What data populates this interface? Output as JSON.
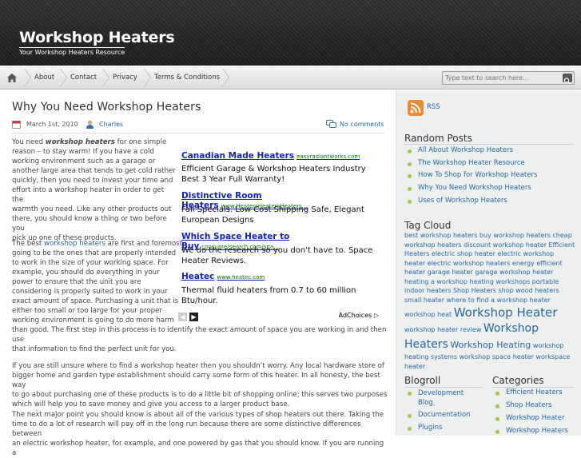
{
  "site": {
    "title": "Workshop Heaters",
    "description": "Your Workshop Heaters Resource"
  },
  "nav": {
    "items": [
      "About",
      "Contact",
      "Privacy",
      "Terms & Conditions"
    ]
  },
  "search": {
    "placeholder": "Type text to search here..."
  },
  "post": {
    "title": "Why You Need Workshop Heaters",
    "date": "March 1st, 2010",
    "author": "Charles",
    "comments": "No comments",
    "p1_lines": [
      "You need ",
      "workshop heaters",
      " for one simple",
      "reason – to stay warm! If you have a cold",
      "working environment such as a garage or",
      "another large area that tends to get cold rather",
      "quickly, then you need to invest your time and",
      "effort into a workshop heater in order to get the",
      "warmth you need. Like any other products out",
      "there, you should know a thing or two before you",
      "pick up one of these products."
    ],
    "p2_first_a": "The best ",
    "p2_link": "workshop heaters",
    "p2_first_b": " are first and foremost",
    "p2_lines": [
      "going to be the ones that are properly intended",
      "to work in the size of your working space. For",
      "example, you should do everything in your",
      "power to ensure that the unit you are",
      "considering is properly suited to work in your",
      "exact amount of space. Purchasing a unit that is",
      "either too small or too large for your proper",
      "working environment is going to do more harm",
      "than good. The first step in this process is to identify the exact amount of space you are working in and then use",
      "that information to find the perfect unit for you."
    ],
    "p3_lines": [
      "If you are still unsure where to find a workshop heater then you shouldn’t worry. Any local hardware store of",
      "bigger home and garden type establishment should carry some form of this heater. In all honesty, the best way",
      "to go about purchasing one of these products is to do a little bit of shopping online; this serves two purposes",
      "which will help you to save money and give you access to a larger product base."
    ],
    "p4_lines": [
      "The next major point you should know is about all of the various types of shop heaters out there. Taking the",
      "time to do a lot of research will pay off in the long run because there are some distinctive differences between",
      "an electric workshop heater, for example, and one powered by gas that you should know. If you are running a"
    ]
  },
  "ads": [
    {
      "title": "Canadian Made Heaters",
      "url": "easyradiantworks.com",
      "text": "Efficient Garage & Workshop Heaters Industry Best 3 Year Full Warranty!"
    },
    {
      "title": "Distinctive Room Heaters",
      "url": "www.HeatersHeatersHeaters…",
      "text": "Fall Specials. Low Cost Shipping Safe, Elegant European Designs"
    },
    {
      "title": "Which Space Heater to Buy",
      "url": "consumersearch.com/spa…",
      "text": "We do the research so you don't have to. Space Heater Reviews."
    },
    {
      "title": "Heatec",
      "url": "www.heatec.com",
      "text": "Thermal fluid heaters from 0.7 to 60 million Btu/hour."
    }
  ],
  "adchoices": "AdChoices",
  "sidebar": {
    "rss": "RSS",
    "random_title": "Random Posts",
    "random_posts": [
      "All About Workshop Heaters",
      "The Workshop Heater Resource",
      "How To Shop for Workshop Heaters",
      "Why You Need Workshop Heaters",
      "Uses of Workshop Heaters"
    ],
    "tag_title": "Tag Cloud",
    "tags_small_1": "best workshop heaters buy workshop heaters cheap workshop heaters discount workshop heater Efficient Heaters electric shop heater electric workshop heater electric workshop heaters energy efficient heater garage heater garage workshop heater heating a workshop heating workshops portable indoor heaters Shop Heaters shop wood heaters small heater where to find a workshop heater workshop heat",
    "tag_big_1": "Workshop Heater",
    "tag_after_1": " workshop heater review ",
    "tag_big_2": "Workshop Heaters",
    "tag_mid": "Workshop Heating",
    "tag_after_2": " workshop heating systems workshop space heater workspace heater",
    "blogroll_title": "Blogroll",
    "blogroll": [
      "Development Blog",
      "Documentation",
      "Plugins"
    ],
    "categories_title": "Categories",
    "categories": [
      "Efficient Heaters",
      "Shop Heaters",
      "Workshop Heater",
      "Workshop Heaters"
    ]
  },
  "colors": {
    "link": "#2767a5",
    "accent": "#a9c44a",
    "ad_title": "#1122cc"
  }
}
